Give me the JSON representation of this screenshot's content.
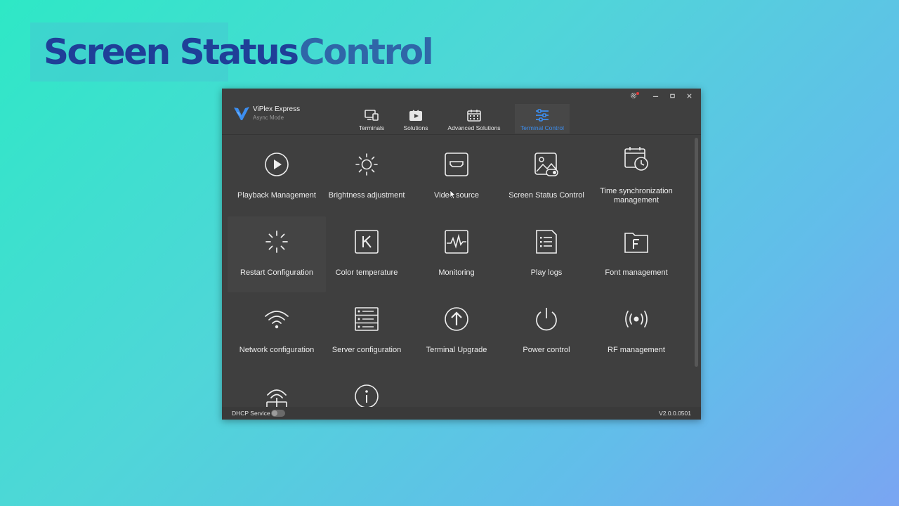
{
  "banner": {
    "title_part1": "Screen Status",
    "title_part2": "Control"
  },
  "app": {
    "name": "ViPlex Express",
    "mode": "Async Mode",
    "accent_color": "#3c8ef0"
  },
  "nav": {
    "tabs": [
      {
        "label": "Terminals",
        "icon": "monitor-icon"
      },
      {
        "label": "Solutions",
        "icon": "play-icon"
      },
      {
        "label": "Advanced Solutions",
        "icon": "calendar-icon"
      },
      {
        "label": "Terminal Control",
        "icon": "sliders-icon",
        "active": true
      }
    ]
  },
  "window_controls": [
    "settings-icon",
    "minimize-icon",
    "maximize-icon",
    "close-icon"
  ],
  "tiles": [
    {
      "label": "Playback Management",
      "icon": "play-circle-icon"
    },
    {
      "label": "Brightness adjustment",
      "icon": "sun-icon"
    },
    {
      "label": "Video source",
      "icon": "hdmi-icon"
    },
    {
      "label": "Screen Status Control",
      "icon": "screen-status-icon"
    },
    {
      "label": "Time synchronization management",
      "icon": "calendar-clock-icon"
    },
    {
      "label": "Restart Configuration",
      "icon": "loading-icon"
    },
    {
      "label": "Color temperature",
      "icon": "k-icon"
    },
    {
      "label": "Monitoring",
      "icon": "monitor-wave-icon"
    },
    {
      "label": "Play logs",
      "icon": "log-icon"
    },
    {
      "label": "Font management",
      "icon": "font-folder-icon"
    },
    {
      "label": "Network configuration",
      "icon": "wifi-icon"
    },
    {
      "label": "Server configuration",
      "icon": "server-icon"
    },
    {
      "label": "Terminal Upgrade",
      "icon": "upgrade-icon"
    },
    {
      "label": "Power control",
      "icon": "power-icon"
    },
    {
      "label": "RF management",
      "icon": "rf-icon"
    },
    {
      "label": "",
      "icon": "antenna-icon"
    },
    {
      "label": "",
      "icon": "info-icon"
    }
  ],
  "status_bar": {
    "dhcp_label": "DHCP Service",
    "dhcp_enabled": false,
    "version": "V2.0.0.0501"
  }
}
